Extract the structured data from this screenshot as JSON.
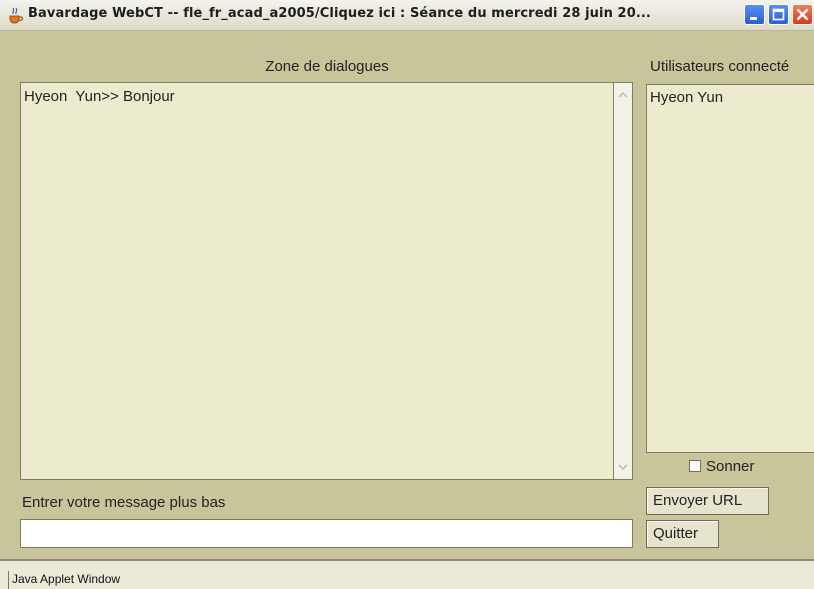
{
  "window": {
    "title": "Bavardage WebCT -- fle_fr_acad_a2005/Cliquez ici : Séance du mercredi 28 juin 20...",
    "icon": "java-cup-icon",
    "controls": [
      "minimize-icon",
      "maximize-icon",
      "close-icon"
    ]
  },
  "chat": {
    "dialog_label": "Zone de dialogues",
    "messages": [
      "Hyeon  Yun>> Bonjour"
    ]
  },
  "users": {
    "label": "Utilisateurs connecté",
    "items": [
      "Hyeon Yun"
    ]
  },
  "options": {
    "sonner_label": "Sonner",
    "sonner_checked": false
  },
  "compose": {
    "label": "Entrer votre message plus bas",
    "value": ""
  },
  "buttons": {
    "send_url": "Envoyer URL",
    "quit": "Quitter"
  },
  "status": {
    "text": "Java Applet Window"
  },
  "colors": {
    "panel": "#c8c59b",
    "field": "#ecebcd",
    "title_text": "#1e1e1e"
  }
}
